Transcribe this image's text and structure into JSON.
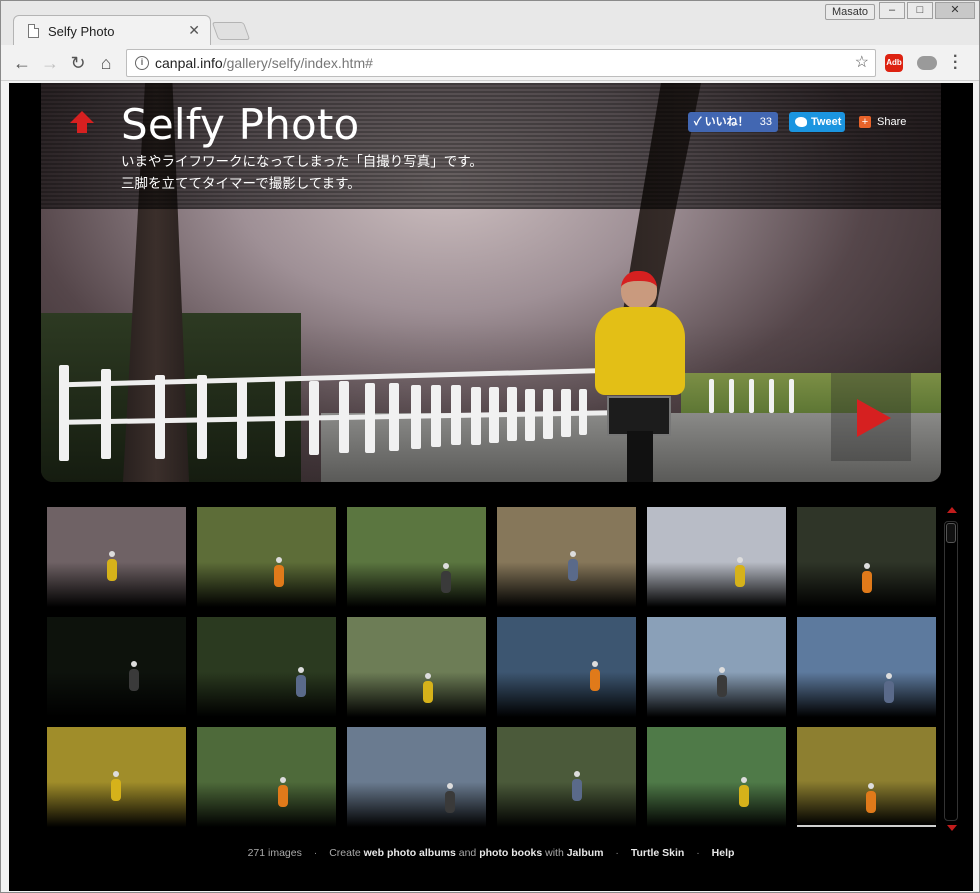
{
  "browser": {
    "tab_title": "Selfy Photo",
    "user_name": "Masato",
    "url_host": "canpal.info",
    "url_path": "/gallery/selfy/index.htm#",
    "ext_label": "Adb"
  },
  "header": {
    "title": "Selfy Photo",
    "desc_line1": "いまやライフワークになってしまった「自撮り写真」です。",
    "desc_line2": "三脚を立ててタイマーで撮影してます。"
  },
  "social": {
    "like_label": "いいね！",
    "like_count": "33",
    "tweet_label": "Tweet",
    "share_label": "Share"
  },
  "thumbnails": [
    {
      "scene": "cherry-blossom-path",
      "bg": "#6f6265"
    },
    {
      "scene": "pink-flowers-road",
      "bg": "#5d6d38"
    },
    {
      "scene": "green-hills-road",
      "bg": "#5b7640"
    },
    {
      "scene": "path-along-fields",
      "bg": "#86775a"
    },
    {
      "scene": "snowy-shrine",
      "bg": "#b8bcc6"
    },
    {
      "scene": "snowy-forest",
      "bg": "#2f3528"
    },
    {
      "scene": "tunnel-exit",
      "bg": "#0d120c"
    },
    {
      "scene": "dark-forest-path",
      "bg": "#2b3a20"
    },
    {
      "scene": "river-steps",
      "bg": "#6d7d56"
    },
    {
      "scene": "seaside-road",
      "bg": "#3d5671"
    },
    {
      "scene": "sea-backlit",
      "bg": "#8aa0b8"
    },
    {
      "scene": "seaside-railing",
      "bg": "#5d7a9e"
    },
    {
      "scene": "golden-rice-field",
      "bg": "#a08d2a"
    },
    {
      "scene": "village-canal",
      "bg": "#4e6a3a"
    },
    {
      "scene": "old-house-road",
      "bg": "#6a7b90"
    },
    {
      "scene": "waterfall",
      "bg": "#4b5a3a"
    },
    {
      "scene": "mountain-valley",
      "bg": "#4f7a48"
    },
    {
      "scene": "rice-field-road",
      "bg": "#8d7f30"
    }
  ],
  "footer": {
    "count": "271 images",
    "create": "Create",
    "web_albums": "web photo albums",
    "and": "and",
    "photo_books": "photo books",
    "with": "with",
    "jalbum": "Jalbum",
    "skin": "Turtle Skin",
    "help": "Help"
  },
  "colors": {
    "accent_red": "#d62020",
    "facebook": "#4267b2",
    "twitter": "#1b95e0",
    "share": "#e8632a"
  }
}
